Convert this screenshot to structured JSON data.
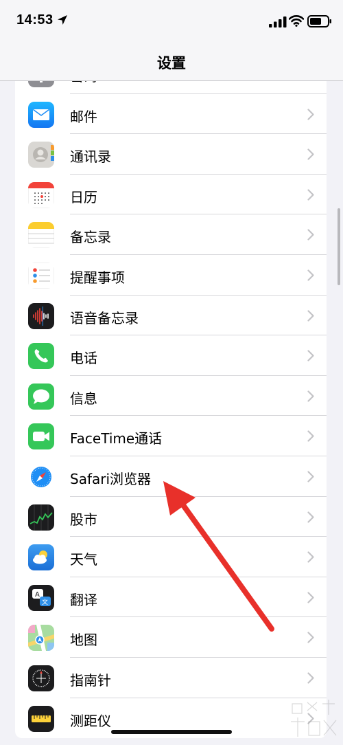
{
  "status": {
    "time": "14:53"
  },
  "nav": {
    "title": "设置"
  },
  "rows": [
    {
      "label": "密码",
      "icon": "passwords-icon"
    },
    {
      "label": "邮件",
      "icon": "mail-icon"
    },
    {
      "label": "通讯录",
      "icon": "contacts-icon"
    },
    {
      "label": "日历",
      "icon": "calendar-icon"
    },
    {
      "label": "备忘录",
      "icon": "notes-icon"
    },
    {
      "label": "提醒事项",
      "icon": "reminders-icon"
    },
    {
      "label": "语音备忘录",
      "icon": "voice-memos-icon"
    },
    {
      "label": "电话",
      "icon": "phone-icon"
    },
    {
      "label": "信息",
      "icon": "messages-icon"
    },
    {
      "label": "FaceTime通话",
      "icon": "facetime-icon"
    },
    {
      "label": "Safari浏览器",
      "icon": "safari-icon"
    },
    {
      "label": "股市",
      "icon": "stocks-icon"
    },
    {
      "label": "天气",
      "icon": "weather-icon"
    },
    {
      "label": "翻译",
      "icon": "translate-icon"
    },
    {
      "label": "地图",
      "icon": "maps-icon"
    },
    {
      "label": "指南针",
      "icon": "compass-icon"
    },
    {
      "label": "测距仪",
      "icon": "measure-icon"
    }
  ],
  "colors": {
    "accent_arrow": "#e8302a",
    "group_bg": "#ffffff",
    "page_bg": "#f2f2f7"
  }
}
